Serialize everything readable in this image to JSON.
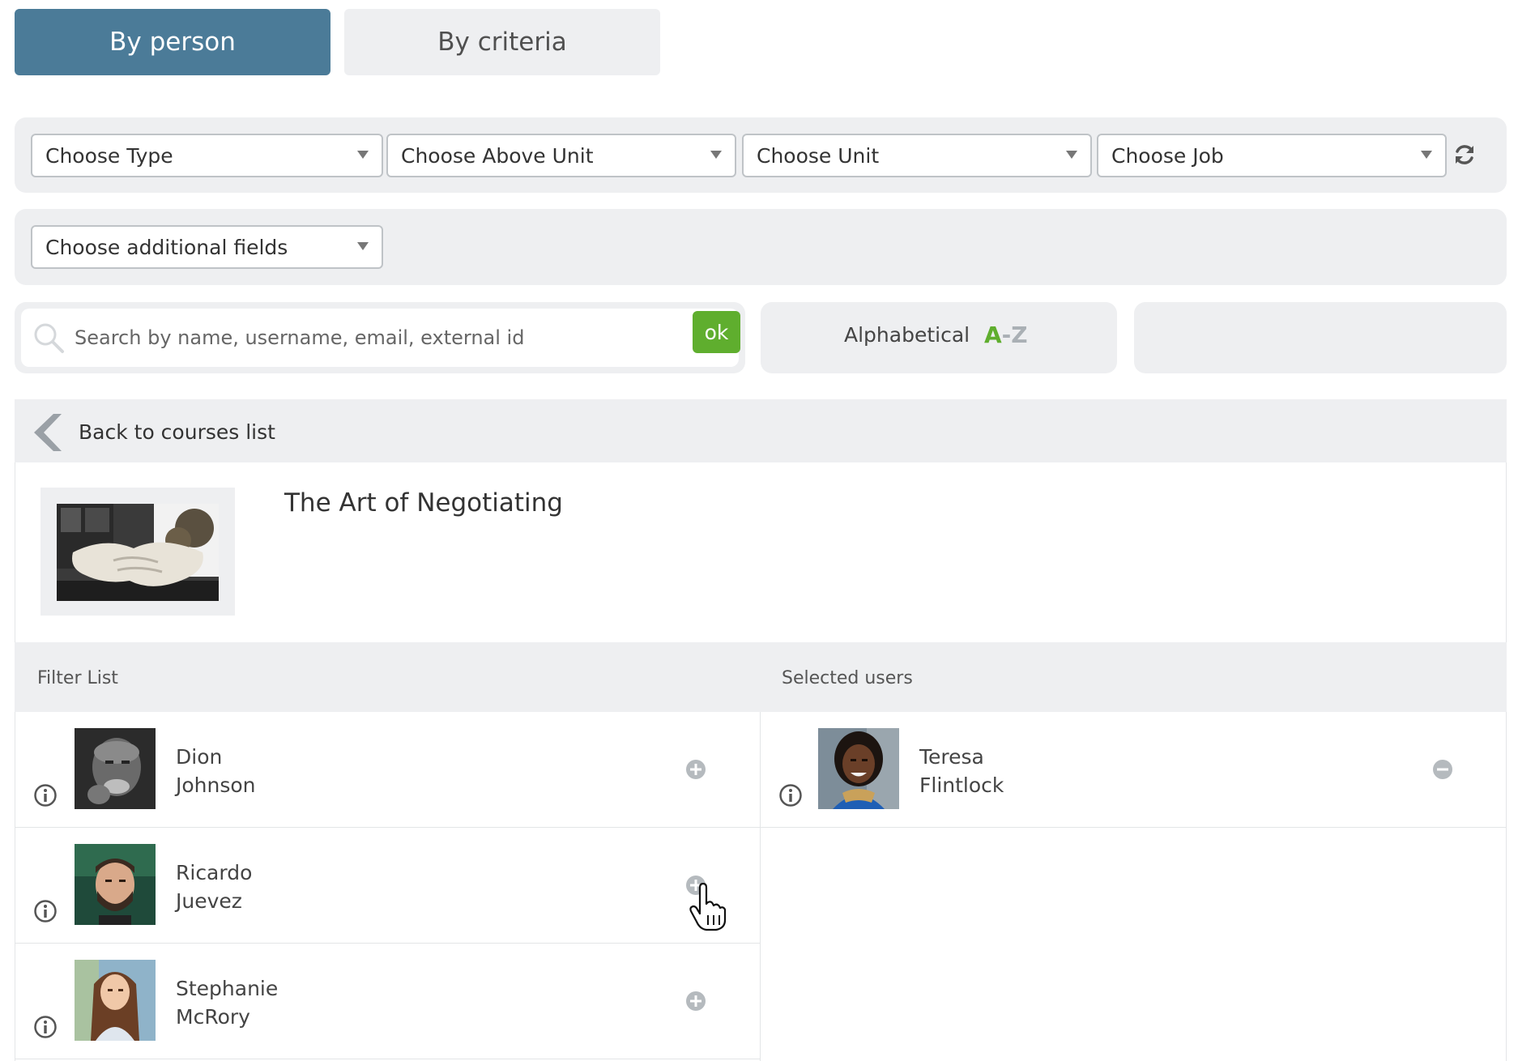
{
  "tabs": [
    {
      "label": "By person",
      "active": true
    },
    {
      "label": "By criteria",
      "active": false
    }
  ],
  "filters": {
    "type": "Choose Type",
    "above_unit": "Choose Above Unit",
    "unit": "Choose Unit",
    "job": "Choose Job",
    "additional_fields": "Choose additional fields"
  },
  "search": {
    "placeholder": "Search by name, username, email, external id",
    "ok_label": "ok"
  },
  "sort": {
    "label": "Alphabetical",
    "az_a": "A",
    "az_dash": "-",
    "az_z": "Z"
  },
  "back": {
    "label": "Back to courses list"
  },
  "course": {
    "title": "The Art of Negotiating"
  },
  "lists": {
    "filter_label": "Filter List",
    "selected_label": "Selected users",
    "filter_users": [
      {
        "first": "Dion",
        "last": "Johnson"
      },
      {
        "first": "Ricardo",
        "last": "Juevez"
      },
      {
        "first": "Stephanie",
        "last": "McRory"
      }
    ],
    "selected_users": [
      {
        "first": "Teresa",
        "last": "Flintlock"
      }
    ]
  },
  "icons": {
    "add": "plus-circle-icon",
    "remove": "minus-circle-icon",
    "info": "info-icon",
    "refresh": "refresh-icon",
    "search": "search-icon",
    "back": "chevron-left-icon"
  },
  "colors": {
    "tab_active": "#4b7b98",
    "ok_button": "#5fae2e",
    "panel_bg": "#eeeff1"
  }
}
